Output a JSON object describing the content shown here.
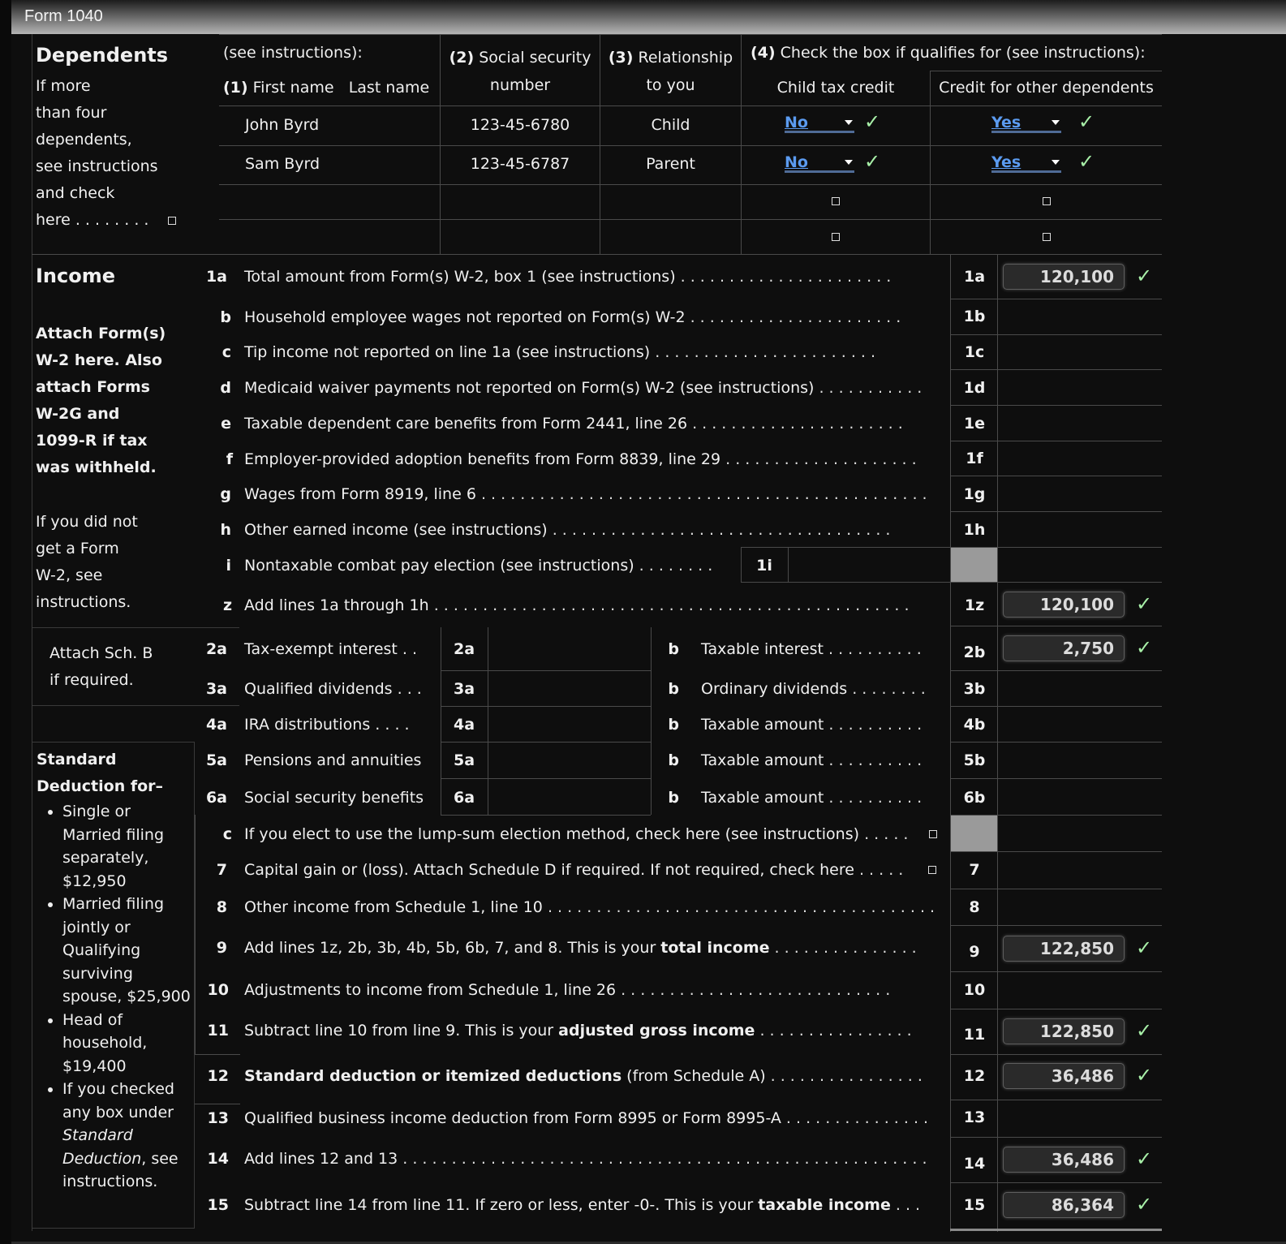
{
  "window": {
    "title": "Form 1040"
  },
  "dependents": {
    "section_title": "Dependents",
    "side_note_lines": [
      "If more",
      "than four",
      "dependents,",
      "see instructions",
      "and check",
      "here . . . . . . . ."
    ],
    "header_see_instructions": "(see instructions):",
    "col1_num": "(1)",
    "col1_label": "First name",
    "col1_label2": "Last name",
    "col2_num": "(2)",
    "col2_label_line1": "Social security",
    "col2_label_line2": "number",
    "col3_num": "(3)",
    "col3_label_line1": "Relationship",
    "col3_label_line2": "to you",
    "col4_num": "(4)",
    "col4_label": "Check the box if qualifies for (see instructions):",
    "col4a_label": "Child tax credit",
    "col4b_label": "Credit for other dependents",
    "rows": [
      {
        "name": "John Byrd",
        "ssn": "123-45-6780",
        "relationship": "Child",
        "child_tax_credit": "No",
        "other_credit": "Yes"
      },
      {
        "name": "Sam Byrd",
        "ssn": "123-45-6787",
        "relationship": "Parent",
        "child_tax_credit": "No",
        "other_credit": "Yes"
      },
      {
        "name": "",
        "ssn": "",
        "relationship": "",
        "child_tax_credit": "",
        "other_credit": ""
      },
      {
        "name": "",
        "ssn": "",
        "relationship": "",
        "child_tax_credit": "",
        "other_credit": ""
      }
    ]
  },
  "income": {
    "section_title": "Income",
    "attach_w2_lines": [
      "Attach Form(s)",
      "W-2 here. Also",
      "attach Forms",
      "W-2G and",
      "1099-R if tax",
      "was withheld."
    ],
    "no_w2_lines": [
      "If you did not",
      "get a Form",
      "W-2, see",
      "instructions."
    ],
    "attach_schb_lines": [
      "Attach Sch. B",
      "if required."
    ],
    "std_deduction_title_1": "Standard",
    "std_deduction_title_2": "Deduction for–",
    "std_deduction_items": [
      "Single or Married filing separately, $12,950",
      "Married filing jointly or Qualifying surviving spouse, $25,900",
      "Head of household, $19,400"
    ],
    "std_deduction_last_pre": "If you checked any box under",
    "std_deduction_last_em": "Standard Deduction",
    "std_deduction_last_post": ", see instructions.",
    "lines": {
      "1a": {
        "num": "1a",
        "text": "Total amount from Form(s) W-2, box 1 (see instructions)",
        "dots": " . . . . . . . . . . . . . . . . . . . . . .",
        "box": "1a",
        "value": "120,100"
      },
      "1b": {
        "num": "b",
        "text": "Household employee wages not reported on Form(s) W-2",
        "dots": " . . . . . . . . . . . . . . . . . . . . . .",
        "box": "1b",
        "value": ""
      },
      "1c": {
        "num": "c",
        "text": "Tip income not reported on line 1a (see instructions)",
        "dots": " . . . . . . . . . . . . . . . . . . . . . . .",
        "box": "1c",
        "value": ""
      },
      "1d": {
        "num": "d",
        "text": "Medicaid waiver payments not reported on Form(s) W-2 (see instructions)",
        "dots": " . . . . . . . . . . .",
        "box": "1d",
        "value": ""
      },
      "1e": {
        "num": "e",
        "text": "Taxable dependent care benefits from Form 2441, line 26",
        "dots": " . . . . . . . . . . . . . . . . . . . . . .",
        "box": "1e",
        "value": ""
      },
      "1f": {
        "num": "f",
        "text": "Employer-provided adoption benefits from Form 8839, line 29",
        "dots": " . . . . . . . . . . . . . . . . . . . .",
        "box": "1f",
        "value": ""
      },
      "1g": {
        "num": "g",
        "text": "Wages from Form 8919, line 6",
        "dots": " . . . . . . . . . . . . . . . . . . . . . . . . . . . . . . . . . . . . . . . . . . . . . .",
        "box": "1g",
        "value": ""
      },
      "1h": {
        "num": "h",
        "text": "Other earned income (see instructions)",
        "dots": " . . . . . . . . . . . . . . . . . . . . . . . . . . . . . . . . . . .",
        "box": "1h",
        "value": ""
      },
      "1i": {
        "num": "i",
        "text": "Nontaxable combat pay election (see instructions)",
        "dots": " . . . . . . . .",
        "box": "1i",
        "value": ""
      },
      "1z": {
        "num": "z",
        "text": "Add lines 1a through 1h",
        "dots": " . . . . . . . . . . . . . . . . . . . . . . . . . . . . . . . . . . . . . . . . . . . . . . . . .",
        "box": "1z",
        "value": "120,100"
      },
      "2a": {
        "num": "2a",
        "text": "Tax-exempt interest . .",
        "box": "2a",
        "value": ""
      },
      "2b": {
        "num": "b",
        "text": "Taxable interest",
        "dots": " . . . . . . . . . .",
        "box": "2b",
        "value": "2,750"
      },
      "3a": {
        "num": "3a",
        "text": "Qualified dividends . . .",
        "box": "3a",
        "value": ""
      },
      "3b": {
        "num": "b",
        "text": "Ordinary dividends",
        "dots": " . . . . . . . .",
        "box": "3b",
        "value": ""
      },
      "4a": {
        "num": "4a",
        "text": "IRA distributions . . . .",
        "box": "4a",
        "value": ""
      },
      "4b": {
        "num": "b",
        "text": "Taxable amount",
        "dots": " . . . . . . . . . .",
        "box": "4b",
        "value": ""
      },
      "5a": {
        "num": "5a",
        "text": "Pensions and annuities",
        "box": "5a",
        "value": ""
      },
      "5b": {
        "num": "b",
        "text": "Taxable amount",
        "dots": " . . . . . . . . . .",
        "box": "5b",
        "value": ""
      },
      "6a": {
        "num": "6a",
        "text": "Social security benefits",
        "box": "6a",
        "value": ""
      },
      "6b": {
        "num": "b",
        "text": "Taxable amount",
        "dots": " . . . . . . . . . .",
        "box": "6b",
        "value": ""
      },
      "6c": {
        "num": "c",
        "text": "If you elect to use the lump-sum election method, check here (see instructions)",
        "dots": " . . . . ."
      },
      "7": {
        "num": "7",
        "text": "Capital gain or (loss). Attach Schedule D if required. If not required, check here",
        "dots": " . . . . .",
        "box": "7",
        "value": ""
      },
      "8": {
        "num": "8",
        "text": "Other income from Schedule 1, line 10",
        "dots": " . . . . . . . . . . . . . . . . . . . . . . . . . . . . . . . . . . . . . . . .",
        "box": "8",
        "value": ""
      },
      "9": {
        "num": "9",
        "text_pre": "Add lines 1z, 2b, 3b, 4b, 5b, 6b, 7, and 8. This is your ",
        "text_bold": "total income",
        "dots": " . . . . . . . . . . . . . . .",
        "box": "9",
        "value": "122,850"
      },
      "10": {
        "num": "10",
        "text": "Adjustments to income from Schedule 1, line 26",
        "dots": " . . . . . . . . . . . . . . . . . . . . . . . . . . . .",
        "box": "10",
        "value": ""
      },
      "11": {
        "num": "11",
        "text_pre": "Subtract line 10 from line 9. This is your ",
        "text_bold": "adjusted gross income",
        "dots": " . . . . . . . . . . . . . . . .",
        "box": "11",
        "value": "122,850"
      },
      "12": {
        "num": "12",
        "text_bold": "Standard deduction or itemized deductions",
        "text_post": " (from Schedule A)",
        "dots": " . . . . . . . . . . . . . . . .",
        "box": "12",
        "value": "36,486"
      },
      "13": {
        "num": "13",
        "text": "Qualified business income deduction from Form 8995 or Form 8995-A",
        "dots": " . . . . . . . . . . . . . . .",
        "box": "13",
        "value": ""
      },
      "14": {
        "num": "14",
        "text": "Add lines 12 and 13",
        "dots": " . . . . . . . . . . . . . . . . . . . . . . . . . . . . . . . . . . . . . . . . . . . . . . . . . . . . . .",
        "box": "14",
        "value": "36,486"
      },
      "15": {
        "num": "15",
        "text_pre": "Subtract line 14 from line 11. If zero or less, enter -0-. This is your ",
        "text_bold": "taxable income",
        "dots": " . . .",
        "box": "15",
        "value": "86,364"
      }
    }
  },
  "colors": {
    "accent_link": "#5b9bf0",
    "check_green": "#a8f0a8",
    "background": "#0e0e0e",
    "grey_cell": "#9a9a9a"
  }
}
